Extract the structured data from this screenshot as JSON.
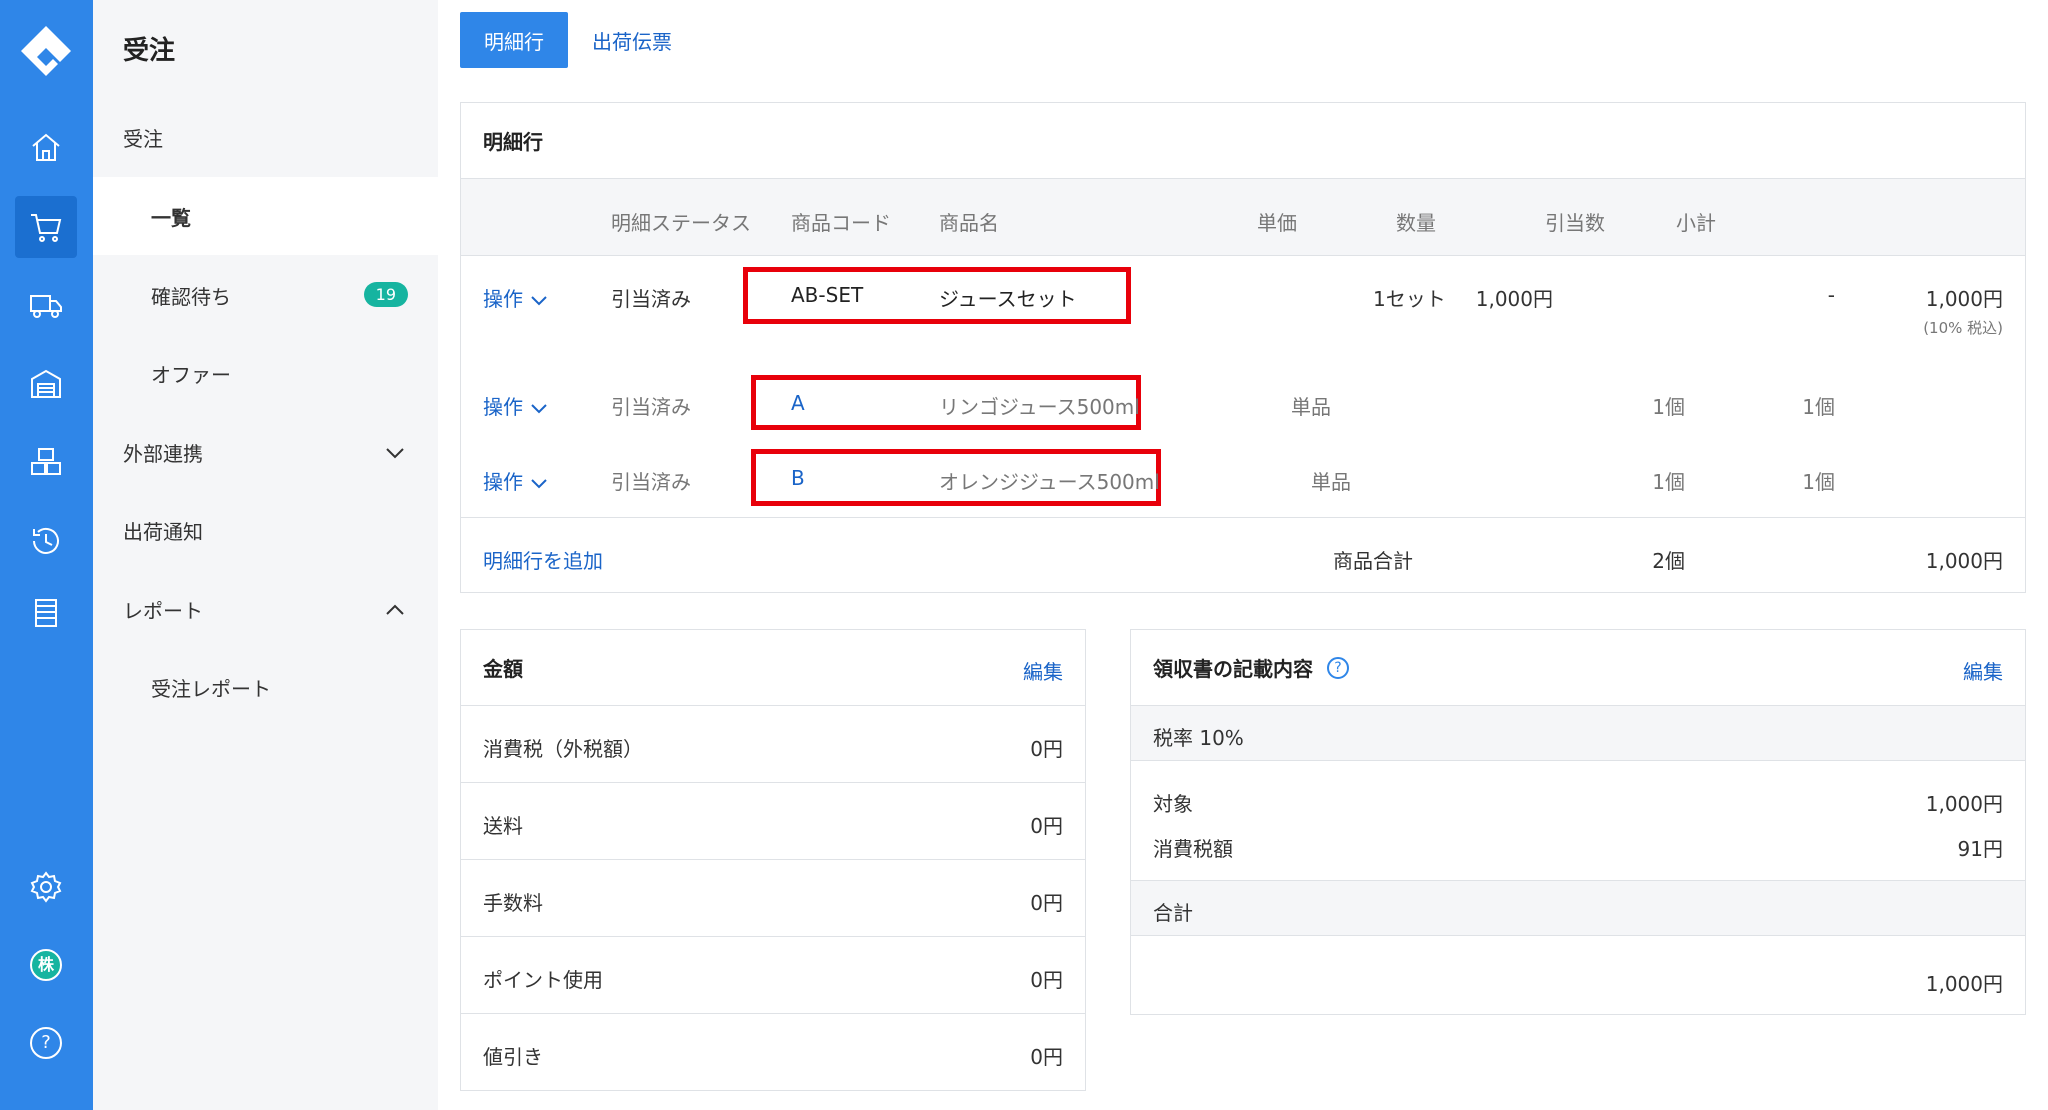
{
  "colors": {
    "primary": "#2f86e8",
    "link": "#1a64c8",
    "badge": "#16b4a0",
    "highlight": "#e8000a"
  },
  "rail": {
    "icons": [
      "logo-icon",
      "home-icon",
      "cart-icon",
      "truck-icon",
      "warehouse-icon",
      "boxes-icon",
      "history-icon",
      "list-icon",
      "gear-icon",
      "company-icon",
      "help-icon"
    ],
    "company_label": "株",
    "help_label": "?"
  },
  "sidebar": {
    "title": "受注",
    "items": [
      {
        "label": "受注"
      },
      {
        "label": "一覧"
      },
      {
        "label": "確認待ち",
        "badge": "19"
      },
      {
        "label": "オファー"
      },
      {
        "label": "外部連携"
      },
      {
        "label": "出荷通知"
      },
      {
        "label": "レポート"
      },
      {
        "label": "受注レポート"
      }
    ]
  },
  "tabs": [
    {
      "label": "明細行"
    },
    {
      "label": "出荷伝票"
    }
  ],
  "lines": {
    "title": "明細行",
    "headers": {
      "status": "明細ステータス",
      "code": "商品コード",
      "name": "商品名",
      "price": "単価",
      "qty": "数量",
      "alloc": "引当数",
      "subtotal": "小計"
    },
    "rows": [
      {
        "op": "操作",
        "status": "引当済み",
        "code": "AB-SET",
        "name": "ジュースセット",
        "price": "1,000円",
        "qty": "1セット",
        "alloc": "-",
        "subtotal": "1,000円",
        "subnote": "(10% 税込)"
      },
      {
        "op": "操作",
        "status": "引当済み",
        "code": "A",
        "name": "リンゴジュース500ml",
        "kind": "単品",
        "qty": "1個",
        "alloc": "1個"
      },
      {
        "op": "操作",
        "status": "引当済み",
        "code": "B",
        "name": "オレンジジュース500ml",
        "kind": "単品",
        "qty": "1個",
        "alloc": "1個"
      }
    ],
    "footer": {
      "add": "明細行を追加",
      "total_label": "商品合計",
      "total_qty": "2個",
      "total": "1,000円"
    }
  },
  "amounts": {
    "title": "金額",
    "edit": "編集",
    "rows": [
      {
        "label": "消費税（外税額）",
        "value": "0円"
      },
      {
        "label": "送料",
        "value": "0円"
      },
      {
        "label": "手数料",
        "value": "0円"
      },
      {
        "label": "ポイント使用",
        "value": "0円"
      },
      {
        "label": "値引き",
        "value": "0円"
      }
    ]
  },
  "receipt": {
    "title": "領収書の記載内容",
    "edit": "編集",
    "help": "?",
    "tax_rate": "税率 10%",
    "target_label": "対象",
    "target": "1,000円",
    "tax_label": "消費税額",
    "tax": "91円",
    "sum_label": "合計",
    "sum": "1,000円"
  }
}
